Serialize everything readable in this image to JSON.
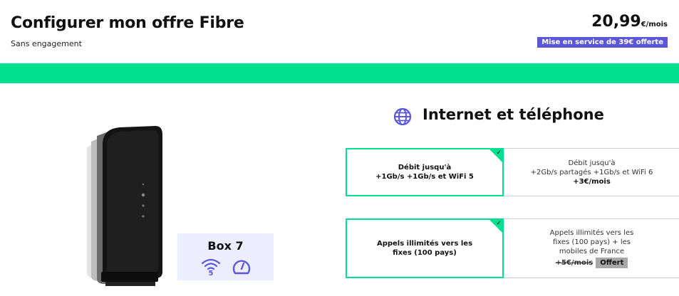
{
  "header": {
    "title": "Configurer mon offre Fibre",
    "subtitle": "Sans engagement",
    "price_amount": "20,99",
    "price_unit": "€/mois",
    "promo": "Mise en service de 39€ offerte"
  },
  "colors": {
    "accent_green": "#00e08f",
    "accent_purple": "#5c57d6",
    "card_bg": "#eceefd"
  },
  "box": {
    "name": "Box 7",
    "icons": [
      "wifi-5-icon",
      "speedometer-icon"
    ],
    "wifi_badge": "5"
  },
  "section": {
    "icon": "globe-icon",
    "title": "Internet et téléphone"
  },
  "options": {
    "debit": {
      "selected": {
        "line1": "Débit jusqu'à",
        "line2": "+1Gb/s +1Gb/s et WiFi 5"
      },
      "alternative": {
        "line1": "Débit jusqu'à",
        "line2": "+2Gb/s partagés +1Gb/s et WiFi 6",
        "price": "+3€/mois"
      }
    },
    "appels": {
      "selected": {
        "line1": "Appels illimités vers les",
        "line2": "fixes (100 pays)"
      },
      "alternative": {
        "line1": "Appels illimités vers les",
        "line2": "fixes (100 pays) + les",
        "line3": "mobiles de France",
        "old_price": "+5€/mois",
        "badge": "Offert"
      }
    },
    "check_glyph": "✓"
  }
}
